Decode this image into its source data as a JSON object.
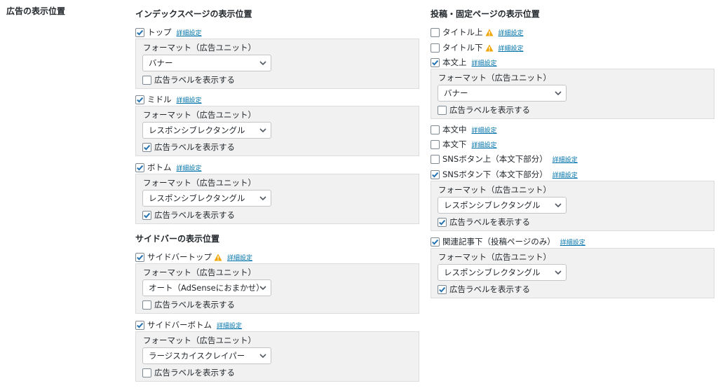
{
  "row_label": "広告の表示位置",
  "detail_link": "詳細設定",
  "sections": {
    "index": {
      "title": "インデックスページの表示位置"
    },
    "sidebar": {
      "title": "サイドバーの表示位置"
    },
    "post": {
      "title": "投稿・固定ページの表示位置"
    }
  },
  "positions": {
    "index_top": {
      "label": "トップ",
      "checked": true
    },
    "index_middle": {
      "label": "ミドル",
      "checked": true
    },
    "index_bottom": {
      "label": "ボトム",
      "checked": true
    },
    "sidebar_top": {
      "label": "サイドバートップ",
      "checked": true,
      "warning": true
    },
    "sidebar_bottom": {
      "label": "サイドバーボトム",
      "checked": true
    },
    "above_title": {
      "label": "タイトル上",
      "checked": false,
      "warning": true
    },
    "below_title": {
      "label": "タイトル下",
      "checked": false,
      "warning": true
    },
    "above_content": {
      "label": "本文上",
      "checked": true
    },
    "middle_content": {
      "label": "本文中",
      "checked": false
    },
    "below_content": {
      "label": "本文下",
      "checked": false
    },
    "above_sns": {
      "label": "SNSボタン上（本文下部分）",
      "checked": false
    },
    "below_sns": {
      "label": "SNSボタン下（本文下部分）",
      "checked": true
    },
    "related": {
      "label": "関連記事下（投稿ページのみ）",
      "checked": true
    }
  },
  "formats": {
    "index_top": {
      "label": "フォーマット（広告ユニット）",
      "value": "バナー",
      "show_label": "広告ラベルを表示する",
      "show_label_checked": false
    },
    "index_middle": {
      "label": "フォーマット（広告ユニット）",
      "value": "レスポンシブレクタングル",
      "show_label": "広告ラベルを表示する",
      "show_label_checked": true
    },
    "index_bottom": {
      "label": "フォーマット（広告ユニット）",
      "value": "レスポンシブレクタングル",
      "show_label": "広告ラベルを表示する",
      "show_label_checked": true
    },
    "sidebar_top": {
      "label": "フォーマット（広告ユニット）",
      "value": "オート（AdSenseにおまかせ）",
      "show_label": "広告ラベルを表示する",
      "show_label_checked": false
    },
    "sidebar_bottom": {
      "label": "フォーマット（広告ユニット）",
      "value": "ラージスカイスクレイパー",
      "show_label": "広告ラベルを表示する",
      "show_label_checked": false
    },
    "above_content": {
      "label": "フォーマット（広告ユニット）",
      "value": "バナー",
      "show_label": "広告ラベルを表示する",
      "show_label_checked": false
    },
    "below_sns": {
      "label": "フォーマット（広告ユニット）",
      "value": "レスポンシブレクタングル",
      "show_label": "広告ラベルを表示する",
      "show_label_checked": true
    },
    "related": {
      "label": "フォーマット（広告ユニット）",
      "value": "レスポンシブレクタングル",
      "show_label": "広告ラベルを表示する",
      "show_label_checked": true
    }
  },
  "colors": {
    "link": "#0073aa",
    "check": "#2271b1",
    "warning": "#f0a500",
    "panel_bg": "#f1f1f1"
  }
}
